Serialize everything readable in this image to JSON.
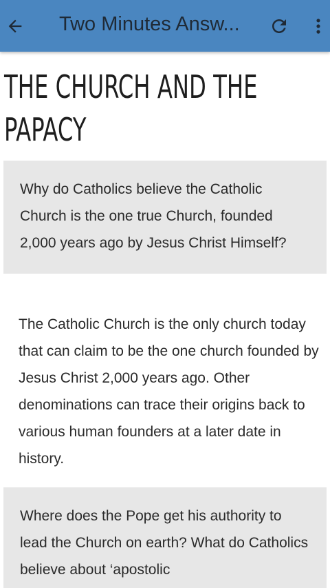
{
  "appbar": {
    "title": "Two Minutes Answ...",
    "background": "#4a86c0",
    "back_icon": "arrow-back-icon",
    "refresh_icon": "refresh-icon",
    "more_icon": "more-vert-icon"
  },
  "article": {
    "title": "THE CHURCH AND THE PAPACY",
    "items": [
      {
        "question": "Why do Catholics believe the Catholic Church is the one true Church, founded 2,000 years ago by Jesus Christ Himself?",
        "answer": "The Catholic Church is the only church today that can claim to be the one church founded by Jesus Christ 2,000 years ago. Other denominations can trace their origins back to various human founders at a later date in history."
      },
      {
        "question": "Where does the Pope get his authority to lead the Church on earth? What do Catholics believe about ‘apostolic"
      }
    ]
  }
}
